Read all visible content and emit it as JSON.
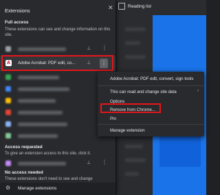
{
  "browser": {
    "reading_list_label": "Reading list"
  },
  "panel": {
    "title": "Extensions",
    "close_glyph": "✕",
    "full_access": {
      "title": "Full access",
      "description": "These extensions can see and change information on this site."
    },
    "acrobat": {
      "icon_letter": "A",
      "name": "Adobe Acrobat: PDF edit, co...",
      "pin_glyph": "⊥",
      "more_glyph": "⋮"
    },
    "access_requested": {
      "title": "Access requested",
      "description": "To give an extension access to this site, click it."
    },
    "no_access": {
      "title": "No access needed",
      "description": "These extensions don't need to see and change"
    },
    "manage_label": "Manage extensions",
    "gear_glyph": "⚙"
  },
  "context_menu": {
    "items": [
      "Adobe Acrobat: PDF edit, convert, sign tools",
      "This can read and change site data",
      "Options",
      "Remove from Chrome...",
      "Pin",
      "Manage extension"
    ],
    "submenu_arrow": "›"
  },
  "colors": {
    "highlight_red": "#e8151b",
    "panel_bg": "#292a2d",
    "accent_blue": "#1a73e8"
  }
}
